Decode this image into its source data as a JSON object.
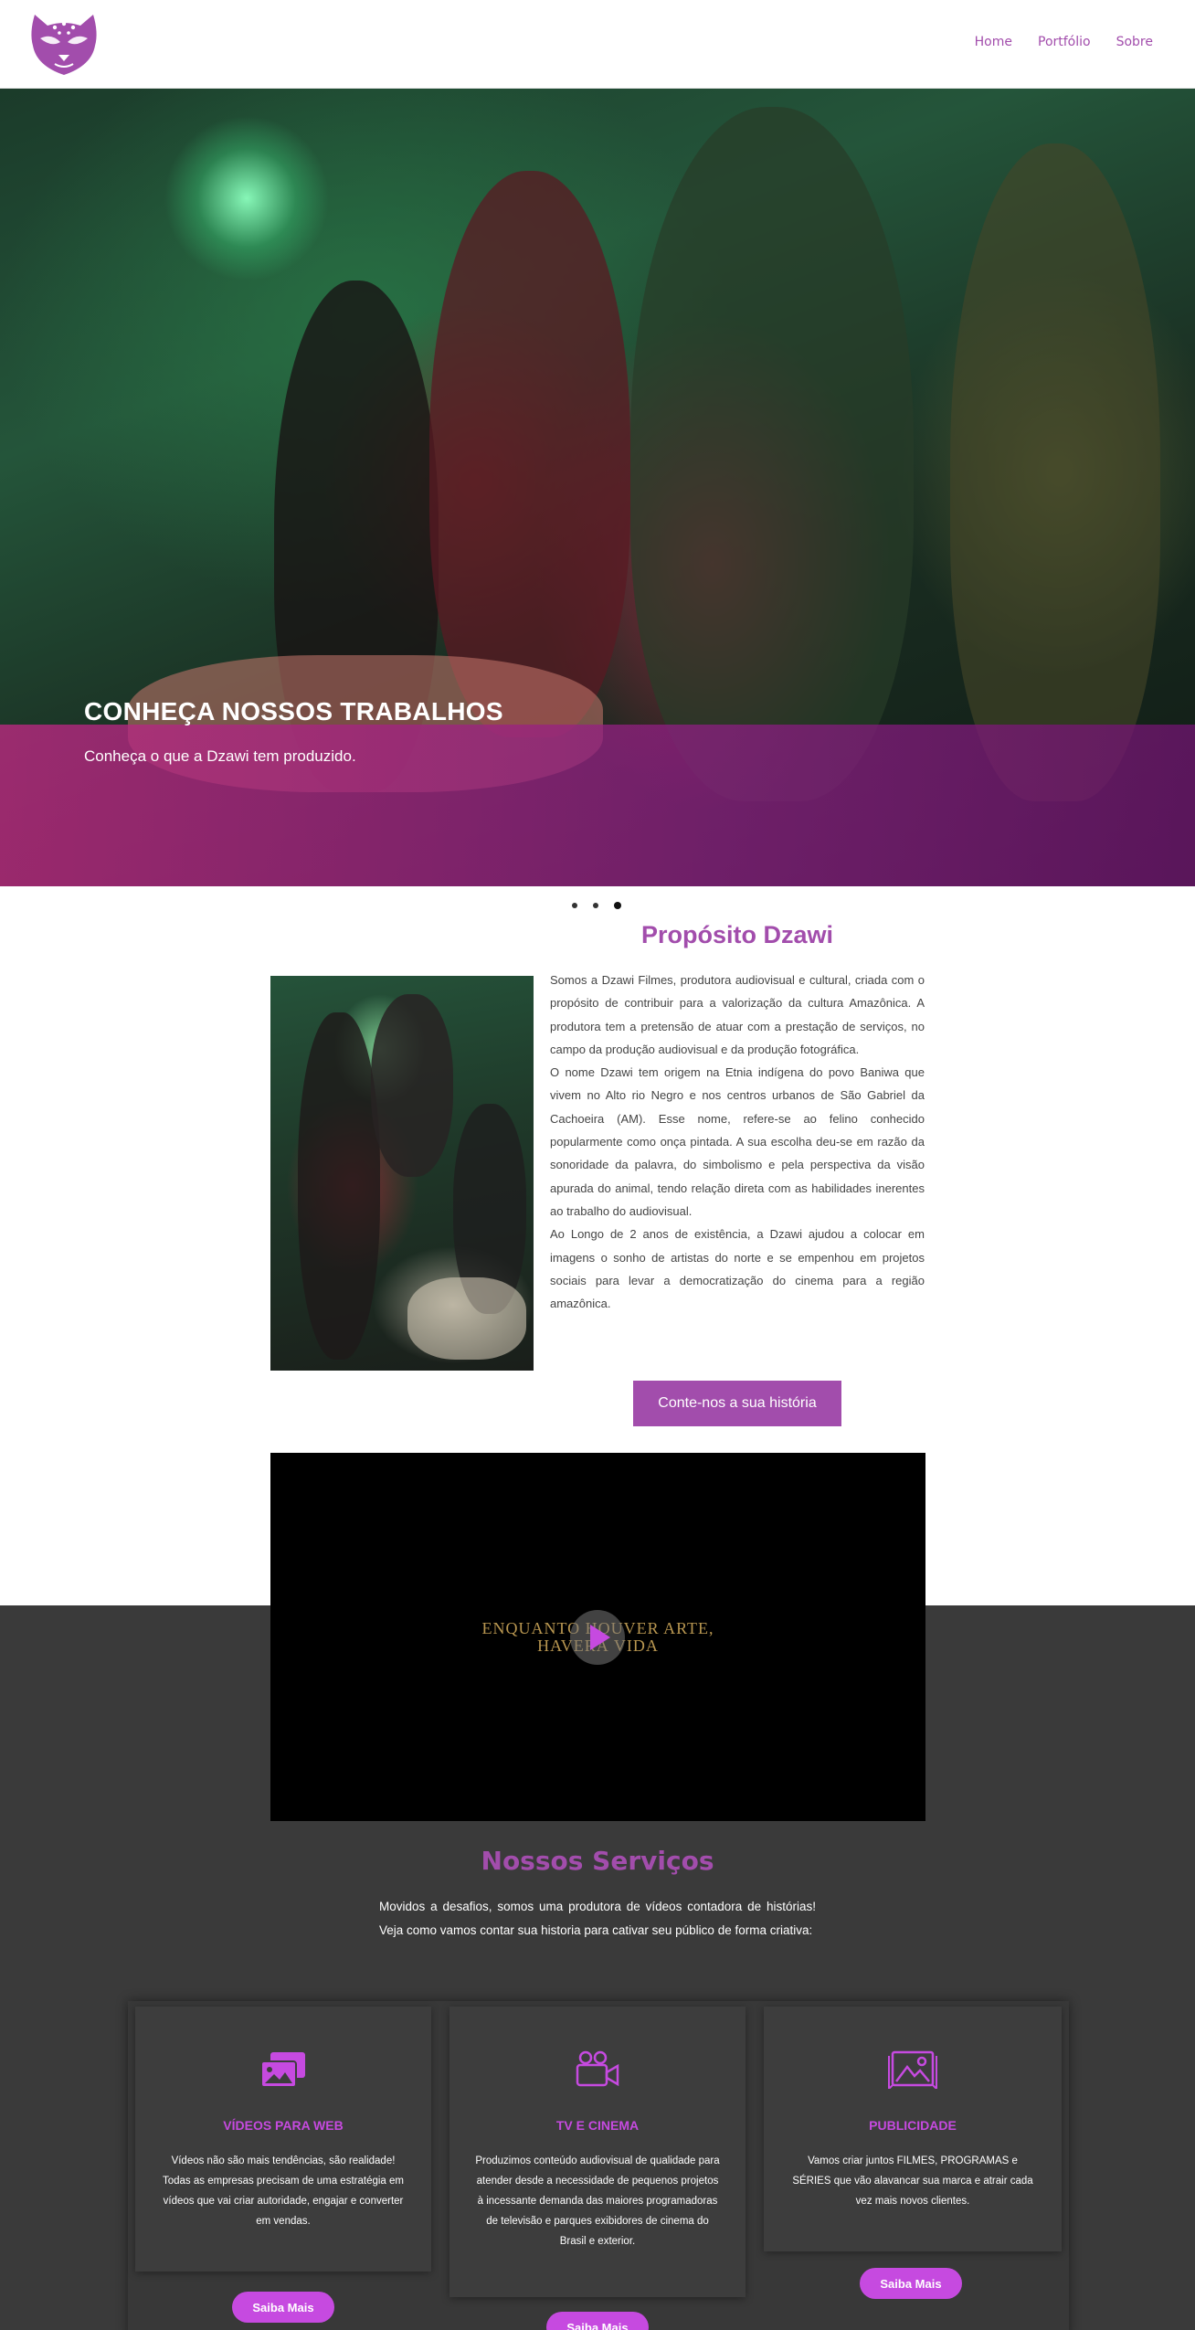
{
  "nav": {
    "home": "Home",
    "portfolio": "Portfólio",
    "sobre": "Sobre"
  },
  "hero": {
    "title": "CONHEÇA NOSSOS TRABALHOS",
    "subtitle": "Conheça o que a Dzawi tem produzido.",
    "slides": 3,
    "active_slide": 3
  },
  "proposito": {
    "title": "Propósito Dzawi",
    "p1": "Somos a Dzawi Filmes, produtora audiovisual e cultural, criada com o propósito de contribuir para a valorização da cultura Amazônica. A produtora tem a pretensão de atuar com a prestação de serviços, no campo da produção audiovisual e da produção fotográfica.",
    "p2": "O nome Dzawi tem origem na Etnia indígena do povo Baniwa que vivem no Alto rio Negro e nos centros urbanos de São Gabriel da Cachoeira (AM). Esse nome, refere-se ao felino conhecido popularmente como onça pintada. A sua escolha deu-se em razão da sonoridade da palavra, do simbolismo e pela perspectiva da visão apurada do animal, tendo relação direta com as habilidades inerentes ao trabalho do audiovisual.",
    "p3": "Ao Longo de 2 anos de existência, a Dzawi ajudou a colocar em imagens o sonho de artistas do norte e se empenhou em projetos sociais para levar a democratização do cinema para a região amazônica.",
    "cta": "Conte-nos a sua história"
  },
  "video": {
    "line1": "ENQUANTO HOUVER ARTE,",
    "line2": "HAVERÁ VIDA"
  },
  "servicos": {
    "title": "Nossos Serviços",
    "intro": "Movidos a desafios, somos uma produtora de vídeos contadora de histórias! Veja como vamos contar sua historia para cativar seu público de forma criativa:",
    "cards": [
      {
        "icon": "photo-film-icon",
        "title": "VÍDEOS PARA WEB",
        "text": "Vídeos não são mais tendências, são realidade! Todas as empresas precisam de uma estratégia em vídeos que vai criar autoridade, engajar e converter em vendas.",
        "button": "Saiba Mais"
      },
      {
        "icon": "video-camera-icon",
        "title": "TV E CINEMA",
        "text": "Produzimos conteúdo audiovisual de qualidade para atender desde a necessidade de pequenos projetos à incessante demanda das maiores programadoras de televisão e parques exibidores de cinema do Brasil e exterior.",
        "button": "Saiba Mais"
      },
      {
        "icon": "image-icon",
        "title": "PUBLICIDADE",
        "text": "Vamos criar juntos FILMES, PROGRAMAS e SÉRIES que vão alavancar sua marca e atrair cada vez mais novos clientes.",
        "button": "Saiba Mais"
      }
    ]
  },
  "colors": {
    "brand": "#a24dac",
    "accent": "#c64ae0",
    "dark_bg": "#3a3a3a"
  }
}
